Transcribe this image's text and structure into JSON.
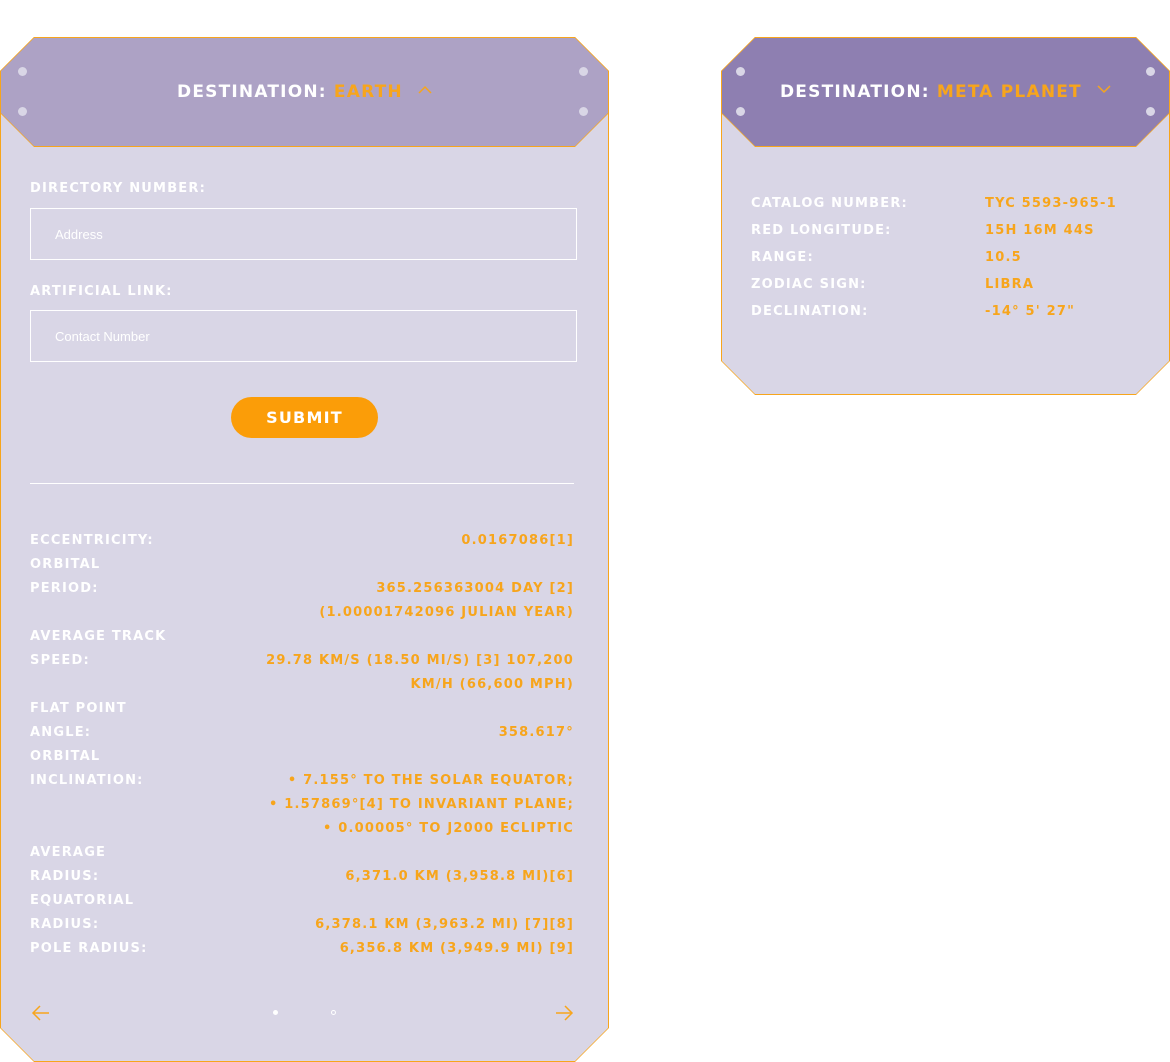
{
  "colors": {
    "accent": "#f7a51c",
    "card_bg": "#d9d6e6",
    "header_left_bg": "#ada2c5",
    "header_right_bg": "#8e7fb1",
    "button_bg": "#fb9d08"
  },
  "left_card": {
    "header": {
      "label": "Destination:",
      "value": "Earth",
      "toggle_icon": "chevron-up-icon"
    },
    "form": {
      "directory_label": "Directory Number:",
      "directory_placeholder": "Address",
      "artificial_label": "Artificial Link:",
      "artificial_placeholder": "Contact Number",
      "submit_label": "Submit"
    },
    "stats": [
      {
        "label": "Eccentricity:",
        "value": "0.0167086[1]"
      },
      {
        "label": "Orbital Period:",
        "value": "365.256363004 day [2] (1.00001742096 Julian year)"
      },
      {
        "label": "Average Track Speed:",
        "value": "29.78 km/s (18.50 mi/s) [3] 107,200 km/h (66,600 mph)"
      },
      {
        "label": "Flat Point Angle:",
        "value": "358.617°"
      },
      {
        "label": "Orbital Inclination:",
        "value_lines": [
          "• 7.155° to the solar equator;",
          "• 1.57869°[4] to invariant plane;",
          "• 0.00005° to J2000 ecliptic"
        ]
      },
      {
        "label": "Average Radius:",
        "value": "6,371.0 km (3,958.8 mi)[6]"
      },
      {
        "label": "Equatorial Radius:",
        "value": "6,378.1 km (3,963.2 mi) [7][8]"
      },
      {
        "label": "Pole Radius:",
        "value": "6,356.8 km (3,949.9 mi) [9]"
      }
    ],
    "pagination": {
      "prev_icon": "arrow-left-icon",
      "next_icon": "arrow-right-icon",
      "pages": 2,
      "current_page": 1
    }
  },
  "right_card": {
    "header": {
      "label": "Destination:",
      "value": "Meta Planet",
      "toggle_icon": "chevron-down-icon"
    },
    "catalog": [
      {
        "label": "Catalog Number:",
        "value": "TYC 5593-965-1"
      },
      {
        "label": "Red longitude:",
        "value": "15h 16m 44s"
      },
      {
        "label": "Range:",
        "value": "10.5"
      },
      {
        "label": "Zodiac sign:",
        "value": "Libra"
      },
      {
        "label": "Declination:",
        "value": "-14° 5' 27\""
      }
    ]
  }
}
